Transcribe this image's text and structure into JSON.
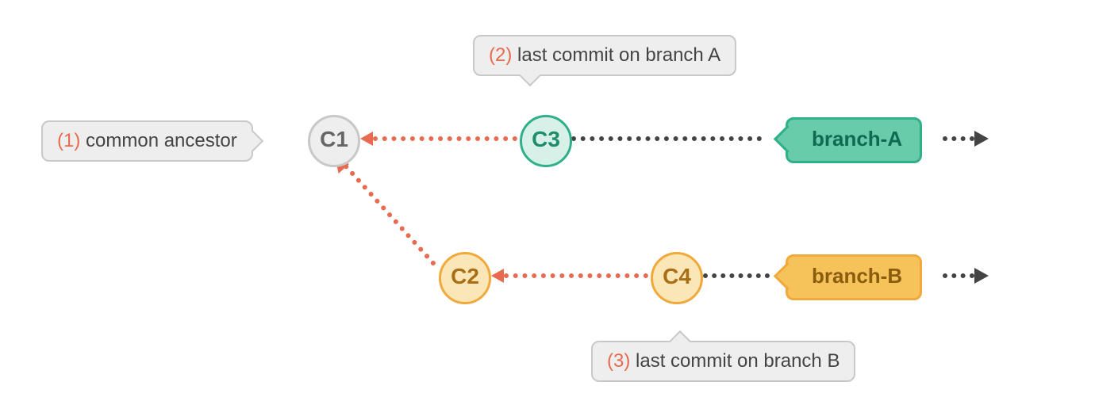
{
  "commits": {
    "c1": "C1",
    "c2": "C2",
    "c3": "C3",
    "c4": "C4"
  },
  "branches": {
    "a": "branch-A",
    "b": "branch-B"
  },
  "callouts": {
    "c1_num": "(1)",
    "c1_text": " common ancestor",
    "c3_num": "(2)",
    "c3_text": " last commit on branch A",
    "c4_num": "(3)",
    "c4_text": " last commit on branch B"
  }
}
